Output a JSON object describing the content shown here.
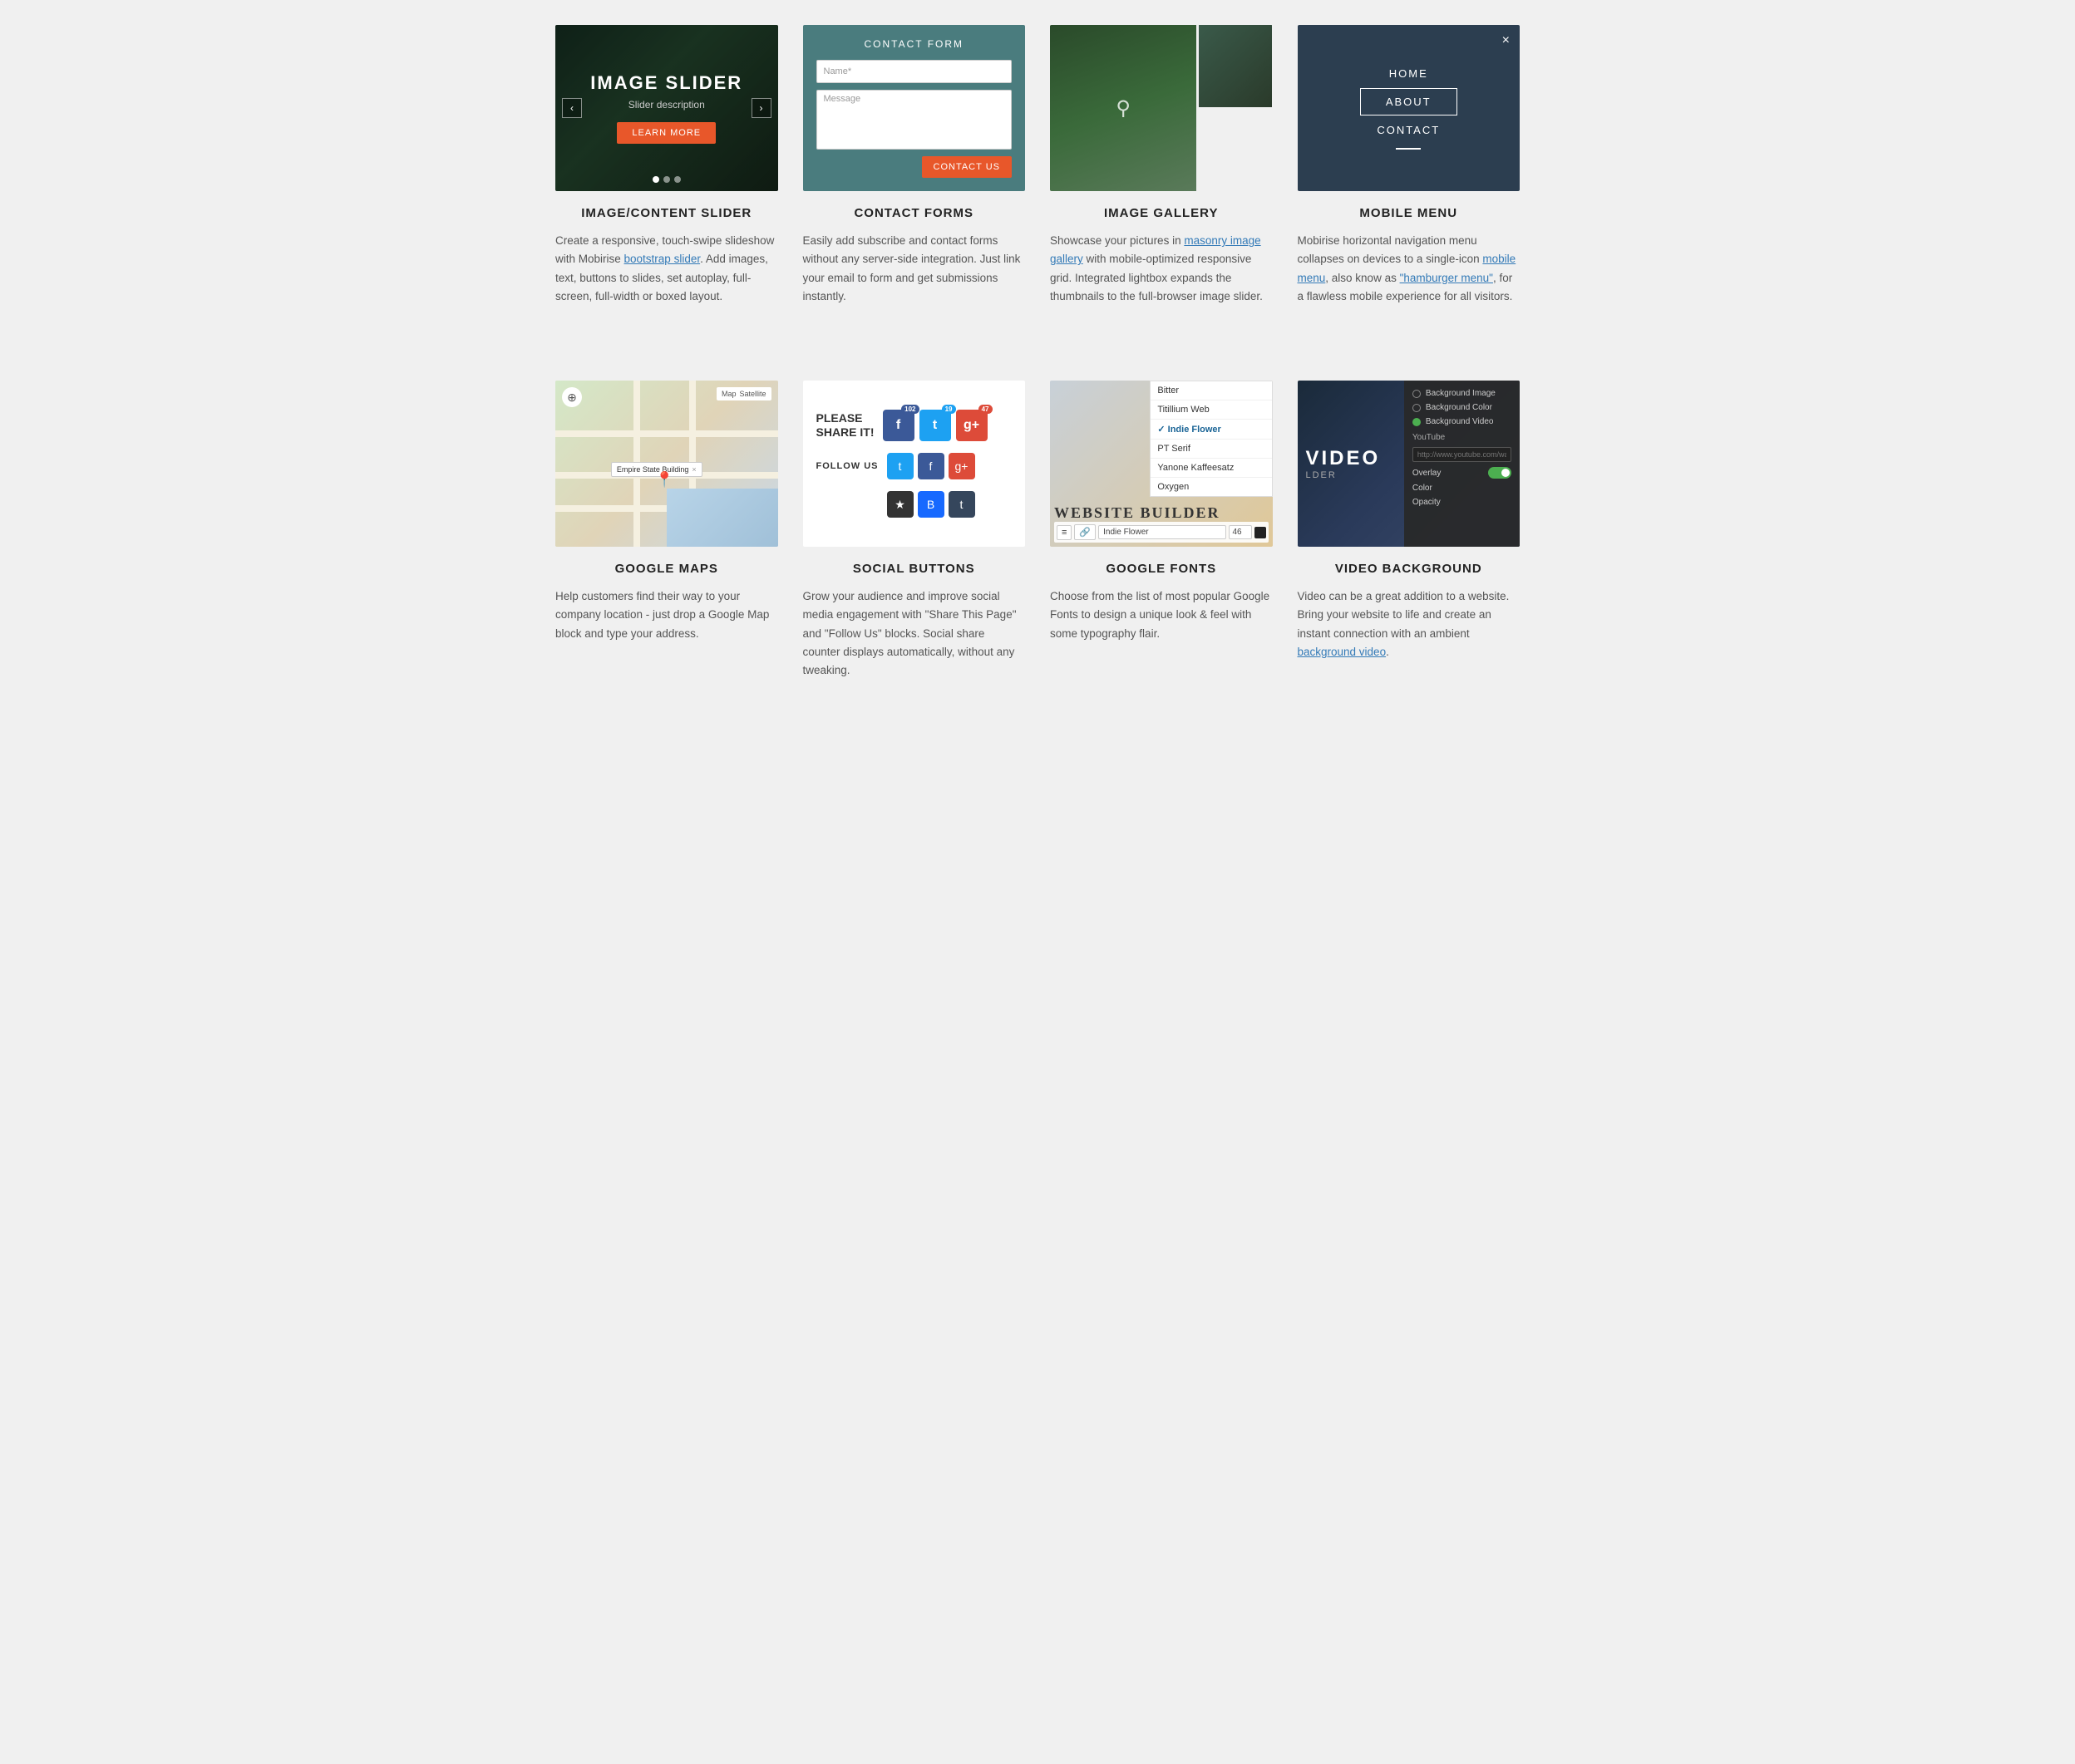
{
  "page": {
    "bg_color": "#f0f0f0"
  },
  "row1": [
    {
      "id": "image-slider",
      "title": "IMAGE/CONTENT SLIDER",
      "preview_type": "slider",
      "slider": {
        "heading": "IMAGE SLIDER",
        "description": "Slider description",
        "button": "LEARN MORE",
        "nav_left": "‹",
        "nav_right": "›",
        "dots": [
          true,
          false,
          false
        ]
      },
      "desc": "Create a responsive, touch-swipe slideshow with Mobirise ",
      "link1": "bootstrap slider",
      "desc2": ". Add images, text, buttons to slides, set autoplay, full-screen, full-width or boxed layout."
    },
    {
      "id": "contact-forms",
      "title": "CONTACT FORMS",
      "preview_type": "contact-form",
      "form": {
        "header": "CONTACT FORM",
        "name_placeholder": "Name*",
        "message_placeholder": "Message",
        "submit": "CONTACT US"
      },
      "desc": "Easily add subscribe and contact forms without any server-side integration. Just link your email to form and get submissions instantly."
    },
    {
      "id": "image-gallery",
      "title": "IMAGE GALLERY",
      "preview_type": "gallery",
      "desc": "Showcase your pictures in ",
      "link1": "masonry image gallery",
      "desc2": " with mobile-optimized responsive grid. Integrated lightbox expands the thumbnails to the full-browser image slider."
    },
    {
      "id": "mobile-menu",
      "title": "MOBILE MENU",
      "preview_type": "mobile-menu",
      "menu": {
        "home": "HOME",
        "about": "ABOUT",
        "contact": "CONTACT",
        "close": "×"
      },
      "desc": "Mobirise horizontal navigation menu collapses on devices to a single-icon ",
      "link1": "mobile menu",
      "desc2": ", also know as ",
      "link2": "\"hamburger menu\"",
      "desc3": ", for a flawless mobile experience for all visitors."
    }
  ],
  "row2": [
    {
      "id": "google-maps",
      "title": "GOOGLE MAPS",
      "preview_type": "maps",
      "map": {
        "label": "Empire State Building",
        "controls": [
          "Map",
          "Satellite"
        ]
      },
      "desc": "Help customers find their way to your company location - just drop a Google Map block and type your address."
    },
    {
      "id": "social-buttons",
      "title": "SOCIAL BUTTONS",
      "preview_type": "social",
      "social": {
        "share_text": "PLEASE\nSHARE IT!",
        "fb_count": "102",
        "tw_count": "19",
        "gp_count": "47",
        "follow_text": "FOLLOW US"
      },
      "desc": "Grow your audience and improve social media engagement with \"Share This Page\" and \"Follow Us\" blocks. Social share counter displays automatically, without any tweaking."
    },
    {
      "id": "google-fonts",
      "title": "GOOGLE FONTS",
      "preview_type": "fonts",
      "fonts": {
        "list": [
          "Bitter",
          "Titillium Web",
          "Indie Flower",
          "PT Serif",
          "Yanone Kaffeesatz",
          "Oxygen"
        ],
        "selected": "Indie Flower",
        "big_text": "WEBSITE BUILDER"
      },
      "desc": "Choose from the list of most popular Google Fonts to design a unique look & feel with some typography flair."
    },
    {
      "id": "video-background",
      "title": "VIDEO BACKGROUND",
      "preview_type": "video",
      "video": {
        "text": "VIDEO",
        "panel": {
          "bg_image": "Background Image",
          "bg_color": "Background Color",
          "bg_video": "Background Video",
          "youtube_label": "YouTube",
          "youtube_placeholder": "http://www.youtube.com/watch?",
          "overlay_label": "Overlay",
          "color_label": "Color",
          "opacity_label": "Opacity"
        }
      },
      "desc": "Video can be a great addition to a website. Bring your website to life and create an instant connection with an ambient ",
      "link1": "background video",
      "desc2": "."
    }
  ]
}
